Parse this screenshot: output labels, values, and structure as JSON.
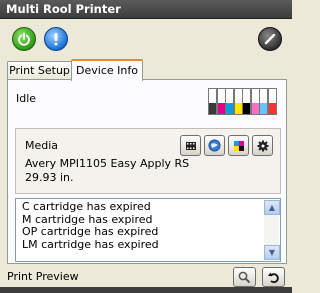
{
  "window": {
    "title": "Multi Rool Printer"
  },
  "toolbar": {
    "power_icon": "power-icon",
    "info_icon": "info-icon",
    "edit_icon": "pencil-icon"
  },
  "tabs": [
    {
      "label": "Print Setup",
      "active": false
    },
    {
      "label": "Device Info",
      "active": true
    }
  ],
  "device": {
    "status": "Idle",
    "inks": [
      {
        "color": "#3a3a3a",
        "level": 0.45
      },
      {
        "color": "#e0008a",
        "level": 0.45
      },
      {
        "color": "#00a0e0",
        "level": 0.45
      },
      {
        "color": "#ffe400",
        "level": 0.45
      },
      {
        "color": "#000000",
        "level": 0.45
      },
      {
        "color": "#ff6fc4",
        "level": 0.45
      },
      {
        "color": "#5fc9ff",
        "level": 0.45
      },
      {
        "color": "#ff3030",
        "level": 0.45
      }
    ]
  },
  "media": {
    "label": "Media",
    "name": "Avery MPI1105 Easy Apply RS",
    "length": "29.93 in.",
    "buttons": [
      "film-icon",
      "globe-icon",
      "color-swatch-icon",
      "gear-icon"
    ]
  },
  "messages": [
    "C cartridge has expired",
    "M cartridge has expired",
    "OP cartridge has expired",
    "LM cartridge has expired"
  ],
  "preview": {
    "label": "Print Preview",
    "zoom_icon": "magnifier-icon",
    "refresh_icon": "undo-icon"
  }
}
